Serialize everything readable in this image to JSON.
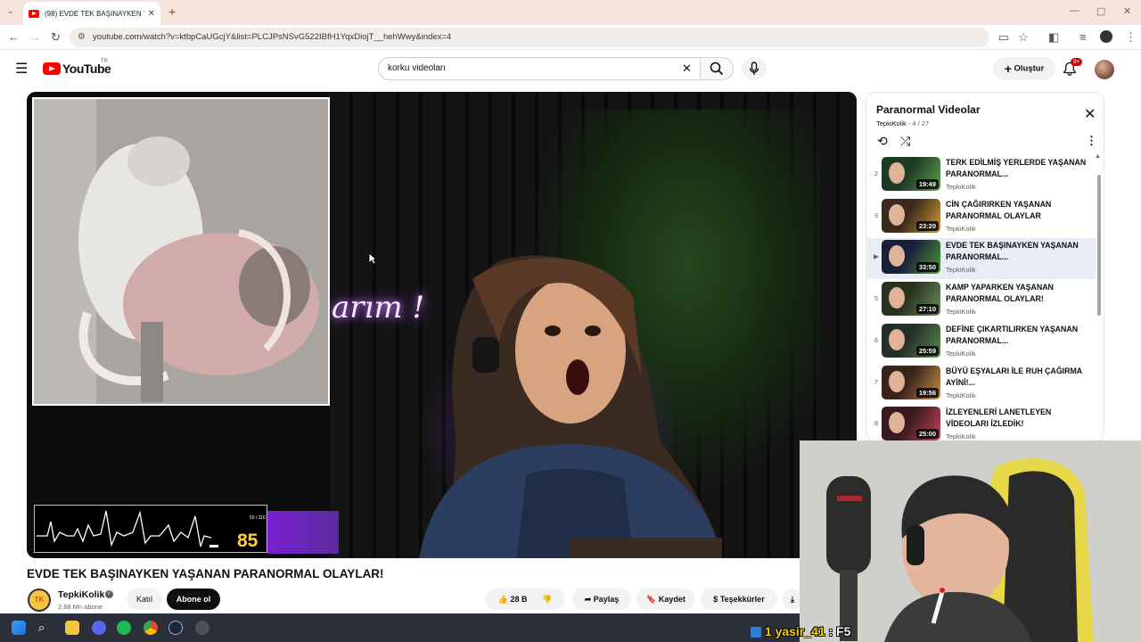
{
  "browser": {
    "tab_title": "(98) EVDE TEK BAŞINAYKEN YA...",
    "url": "youtube.com/watch?v=ktbpCaUGcjY&list=PLCJPsNSvG522IBfH1YqxDiojT__hehWwy&index=4"
  },
  "header": {
    "logo_text": "YouTube",
    "country_code": "TR",
    "search_value": "korku videoları",
    "create_label": "Oluştur",
    "notif_count": "9+"
  },
  "player": {
    "overlay_neon_text": "arım !",
    "heart_rate": "85",
    "heart_rate_label": "50 / 110"
  },
  "video": {
    "title": "EVDE TEK BAŞINAYKEN YAŞANAN PARANORMAL OLAYLAR!",
    "channel": "TepkiKolik",
    "channel_initials": "TK",
    "subscribers": "2,68 Mn abone",
    "join_label": "Katıl",
    "subscribe_label": "Abone ol",
    "likes": "28 B",
    "share_label": "Paylaş",
    "save_label": "Kaydet",
    "thanks_label": "Teşekkürler"
  },
  "playlist": {
    "title": "Paranormal Videolar",
    "owner": "TepkiKolik",
    "position": "- 4 / 27",
    "items": [
      {
        "num": "2",
        "title": "TERK EDİLMİŞ YERLERDE YAŞANAN PARANORMAL...",
        "channel": "TepkiKolik",
        "duration": "19:49"
      },
      {
        "num": "3",
        "title": "CİN ÇAĞIRIRKEN YAŞANAN PARANORMAL OLAYLAR",
        "channel": "TepkiKolik",
        "duration": "23:20"
      },
      {
        "num": "▶",
        "title": "EVDE TEK BAŞINAYKEN YAŞANAN PARANORMAL...",
        "channel": "TepkiKolik",
        "duration": "33:50"
      },
      {
        "num": "5",
        "title": "KAMP YAPARKEN YAŞANAN PARANORMAL OLAYLAR!",
        "channel": "TepkiKolik",
        "duration": "27:10"
      },
      {
        "num": "6",
        "title": "DEFİNE ÇIKARTILIRKEN YAŞANAN PARANORMAL...",
        "channel": "TepkiKolik",
        "duration": "25:59"
      },
      {
        "num": "7",
        "title": "BÜYÜ EŞYALARI İLE RUH ÇAĞIRMA AYİNİ!...",
        "channel": "TepkiKolik",
        "duration": "19:56"
      },
      {
        "num": "8",
        "title": "İZLEYENLERİ LANETLEYEN VİDEOLARI İZLEDİK!",
        "channel": "TepkiKolik",
        "duration": "25:00"
      }
    ]
  },
  "stream": {
    "overlay_count": "1",
    "viewer_name": "yasir_41",
    "viewer_message": ": F5"
  }
}
